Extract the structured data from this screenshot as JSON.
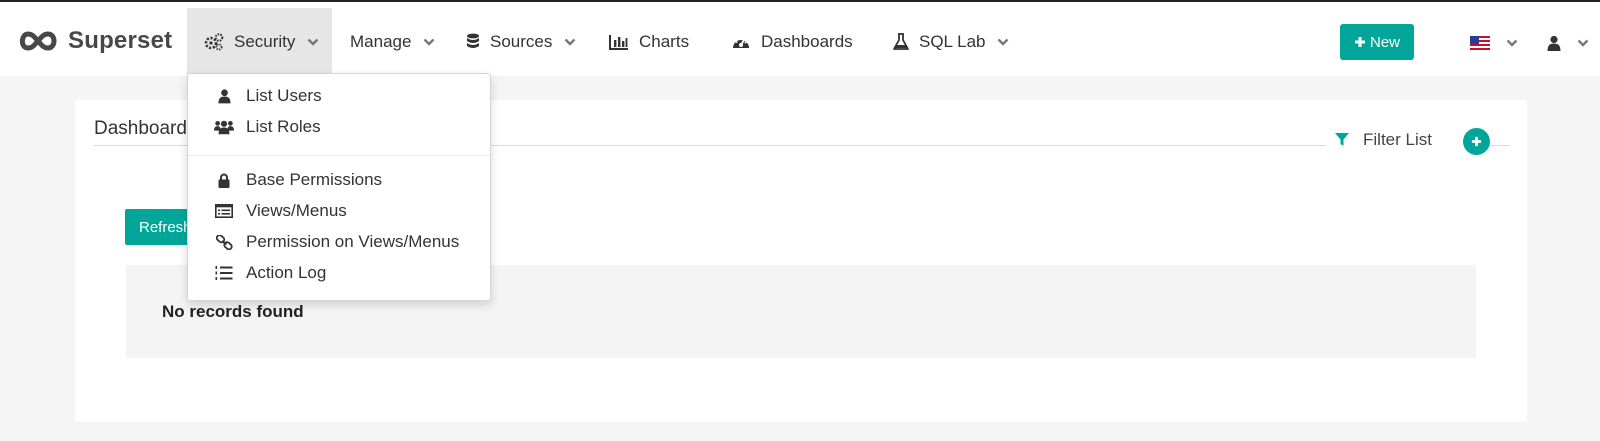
{
  "app": {
    "name": "Superset"
  },
  "nav": {
    "security": "Security",
    "manage": "Manage",
    "sources": "Sources",
    "charts": "Charts",
    "dashboards": "Dashboards",
    "sql_lab": "SQL Lab",
    "new_button": "New"
  },
  "security_menu": {
    "items": [
      {
        "label": "List Users",
        "icon": "user-icon"
      },
      {
        "label": "List Roles",
        "icon": "users-icon"
      },
      {
        "label": "Base Permissions",
        "icon": "lock-icon"
      },
      {
        "label": "Views/Menus",
        "icon": "list-alt-icon"
      },
      {
        "label": "Permission on Views/Menus",
        "icon": "link-icon"
      },
      {
        "label": "Action Log",
        "icon": "list-ol-icon"
      }
    ]
  },
  "panel": {
    "title": "Dashboards",
    "filter_label": "Filter List",
    "refresh_label": "Refresh",
    "empty_text": "No records found"
  },
  "colors": {
    "accent": "#00a699",
    "header_bg": "#ffffff",
    "page_bg": "#f5f5f5"
  }
}
